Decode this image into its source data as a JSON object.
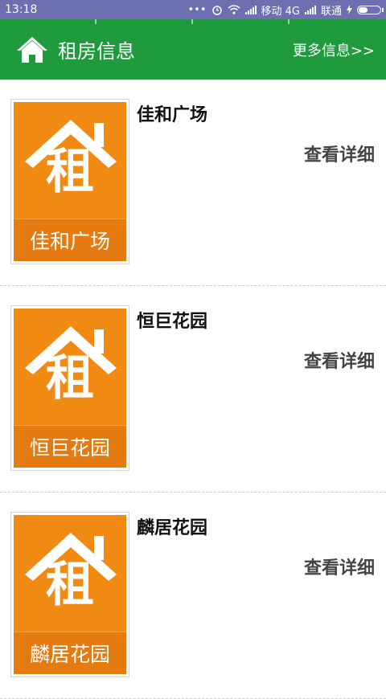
{
  "status_bar": {
    "time": "13:18",
    "dots": "•••",
    "carrier1": "移动 4G",
    "carrier2": "联通"
  },
  "header": {
    "title": "租房信息",
    "more": "更多信息>>",
    "color": "#1f9a3c"
  },
  "listings": [
    {
      "name": "佳和广场",
      "poster_char": "租",
      "poster_label": "佳和广场",
      "detail": "查看详细"
    },
    {
      "name": "恒巨花园",
      "poster_char": "租",
      "poster_label": "恒巨花园",
      "detail": "查看详细"
    },
    {
      "name": "麟居花园",
      "poster_char": "租",
      "poster_label": "麟居花园",
      "detail": "查看详细"
    }
  ],
  "colors": {
    "poster": "#f08a12",
    "status_bar": "#6d6fb0"
  }
}
